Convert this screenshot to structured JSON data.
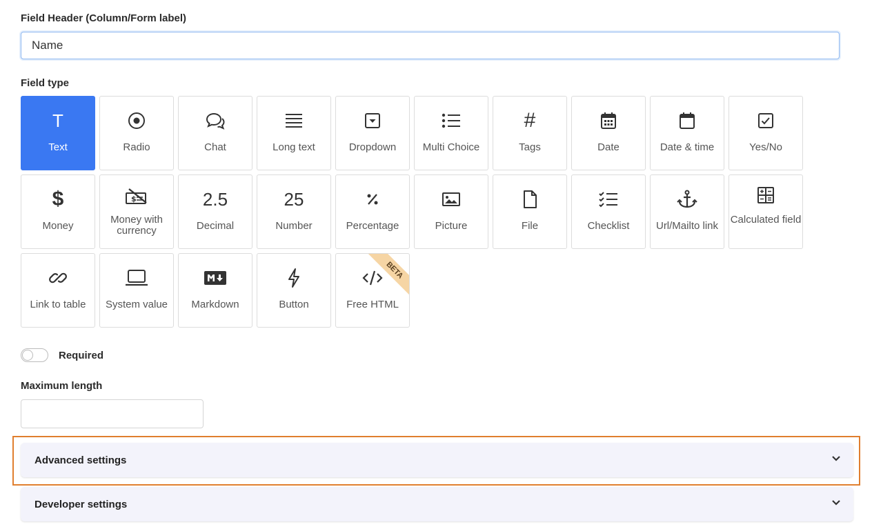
{
  "field_header": {
    "label": "Field Header (Column/Form label)",
    "value": "Name"
  },
  "field_type": {
    "label": "Field type",
    "tiles": [
      {
        "label": "Text",
        "icon": "text-icon",
        "active": true
      },
      {
        "label": "Radio",
        "icon": "radio-icon"
      },
      {
        "label": "Chat",
        "icon": "chat-icon"
      },
      {
        "label": "Long text",
        "icon": "long-text-icon"
      },
      {
        "label": "Dropdown",
        "icon": "dropdown-icon"
      },
      {
        "label": "Multi Choice",
        "icon": "multi-choice-icon"
      },
      {
        "label": "Tags",
        "icon": "hash-icon"
      },
      {
        "label": "Date",
        "icon": "calendar-icon"
      },
      {
        "label": "Date & time",
        "icon": "calendar-time-icon"
      },
      {
        "label": "Yes/No",
        "icon": "checkbox-icon"
      },
      {
        "label": "Money",
        "icon": "dollar-icon"
      },
      {
        "label": "Money with currency",
        "icon": "money-currency-icon"
      },
      {
        "label": "Decimal",
        "icon": "decimal-icon",
        "glyph": "2.5"
      },
      {
        "label": "Number",
        "icon": "number-icon",
        "glyph": "25"
      },
      {
        "label": "Percentage",
        "icon": "percent-icon"
      },
      {
        "label": "Picture",
        "icon": "picture-icon"
      },
      {
        "label": "File",
        "icon": "file-icon"
      },
      {
        "label": "Checklist",
        "icon": "checklist-icon"
      },
      {
        "label": "Url/Mailto link",
        "icon": "anchor-icon"
      },
      {
        "label": "Calculated field",
        "icon": "calculator-icon"
      },
      {
        "label": "Link to table",
        "icon": "link-icon"
      },
      {
        "label": "System value",
        "icon": "laptop-icon"
      },
      {
        "label": "Markdown",
        "icon": "markdown-icon"
      },
      {
        "label": "Button",
        "icon": "lightning-icon"
      },
      {
        "label": "Free HTML",
        "icon": "code-icon",
        "badge": "BETA"
      }
    ]
  },
  "required": {
    "label": "Required",
    "on": false
  },
  "max_length": {
    "label": "Maximum length",
    "value": ""
  },
  "panels": {
    "advanced": "Advanced settings",
    "developer": "Developer settings"
  },
  "colors": {
    "accent": "#3a78f2",
    "highlight": "#e07e2e"
  }
}
